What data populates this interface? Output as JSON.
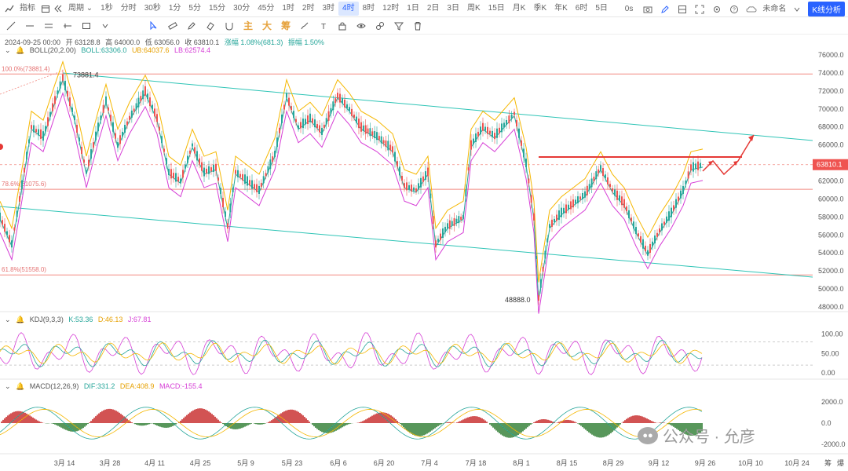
{
  "toolbar": {
    "indicator_label": "指标",
    "period_label": "周期",
    "intervals": [
      "1秒",
      "分时",
      "30秒",
      "1分",
      "5分",
      "15分",
      "30分",
      "45分",
      "1时",
      "2时",
      "3时",
      "4时",
      "8时",
      "12时",
      "1日",
      "2日",
      "3日",
      "周K",
      "15日",
      "月K",
      "季K",
      "年K",
      "6时",
      "5日"
    ],
    "active_interval": "4时",
    "timer": "0s",
    "unnamed_label": "未命名",
    "kline_button": "K线分析"
  },
  "drawtools": {
    "zhu": "主",
    "da": "大",
    "chou": "筹"
  },
  "legend_main": {
    "date": "2024-09-25 00:00",
    "open": "开 63128.8",
    "high": "高 64000.0",
    "low": "低 63056.0",
    "close": "收 63810.1",
    "change": "涨幅 1.08%(681.3)",
    "amplitude": "振幅 1.50%"
  },
  "legend_boll": {
    "name": "BOLL(20,2.00)",
    "boll": "BOLL:63306.0",
    "ub": "UB:64037.6",
    "lb": "LB:62574.4"
  },
  "legend_kdj": {
    "name": "KDJ(9,3,3)",
    "k": "K:53.36",
    "d": "D:46.13",
    "j": "J:67.81"
  },
  "legend_macd": {
    "name": "MACD(12,26,9)",
    "dif": "DIF:331.2",
    "dea": "DEA:408.9",
    "macd": "MACD:-155.4"
  },
  "annotations": {
    "high_label": "73881.4",
    "low_label": "48888.0",
    "fib_100": "100.0%(73881.4)",
    "fib_786": "78.6%(61075.6)",
    "fib_618": "61.8%(51558.0)",
    "current_price": "63810.1"
  },
  "price_axis": [
    "76000.0",
    "74000.0",
    "72000.0",
    "70000.0",
    "68000.0",
    "66000.0",
    "64000.0",
    "62000.0",
    "60000.0",
    "58000.0",
    "56000.0",
    "54000.0",
    "52000.0",
    "50000.0",
    "48000.0"
  ],
  "kdj_axis": [
    "100.00",
    "50.00",
    "0.00"
  ],
  "macd_axis": [
    "2000.0",
    "0.0",
    "-2000.0"
  ],
  "date_axis": [
    "3月 14",
    "3月 28",
    "4月 11",
    "4月 25",
    "5月 9",
    "5月 23",
    "6月 6",
    "6月 20",
    "7月 4",
    "7月 18",
    "8月 1",
    "8月 15",
    "8月 29",
    "9月 12",
    "9月 26",
    "10月 10",
    "10月 24"
  ],
  "corner_labels": {
    "a": "筹",
    "b": "爆"
  },
  "watermark": "公众号 · 允彦",
  "colors": {
    "up": "#26a69a",
    "down": "#ef5350",
    "ub": "#f5b700",
    "boll": "#26a69a",
    "lb": "#d63fd6",
    "channel": "#2ec4b6",
    "fib": "#f28b82",
    "accent": "#2962ff",
    "arrow": "#e53935"
  }
}
